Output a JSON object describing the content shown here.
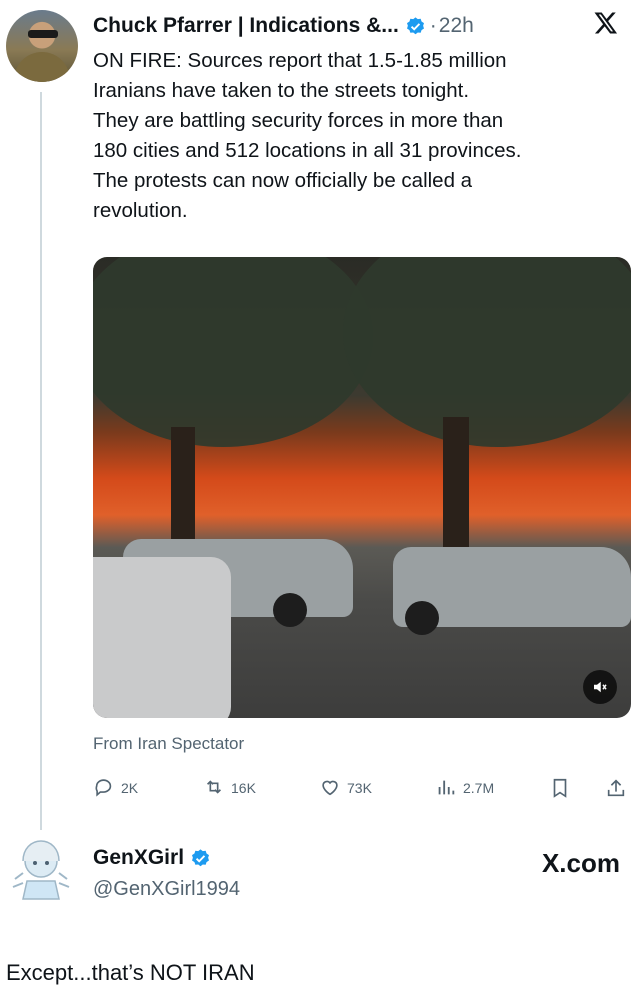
{
  "tweet": {
    "author_name": "Chuck Pfarrer | Indications &...",
    "separator": "·",
    "time": "22h",
    "lines": [
      "ON FIRE:  Sources report that 1.5-1.85 million",
      "Iranians have taken to the streets tonight.",
      "They are battling security forces  in more than",
      "180 cities and 512 locations in all 31 provinces.",
      "The protests can now officially be called a",
      "revolution."
    ],
    "media_source": "From Iran Spectator",
    "stats": {
      "replies": "2K",
      "reposts": "16K",
      "likes": "73K",
      "views": "2.7M"
    }
  },
  "reply": {
    "name": "GenXGirl",
    "handle": "@GenXGirl1994",
    "site": "X.com"
  },
  "caption": "Except...that’s NOT IRAN",
  "colors": {
    "verified": "#1d9bf0",
    "muted_text": "#536471",
    "thread_line": "#cfd9de"
  },
  "icons": [
    "verified-badge-icon",
    "x-logo-icon",
    "reply-icon",
    "repost-icon",
    "like-icon",
    "views-icon",
    "bookmark-icon",
    "share-icon",
    "mute-icon"
  ]
}
